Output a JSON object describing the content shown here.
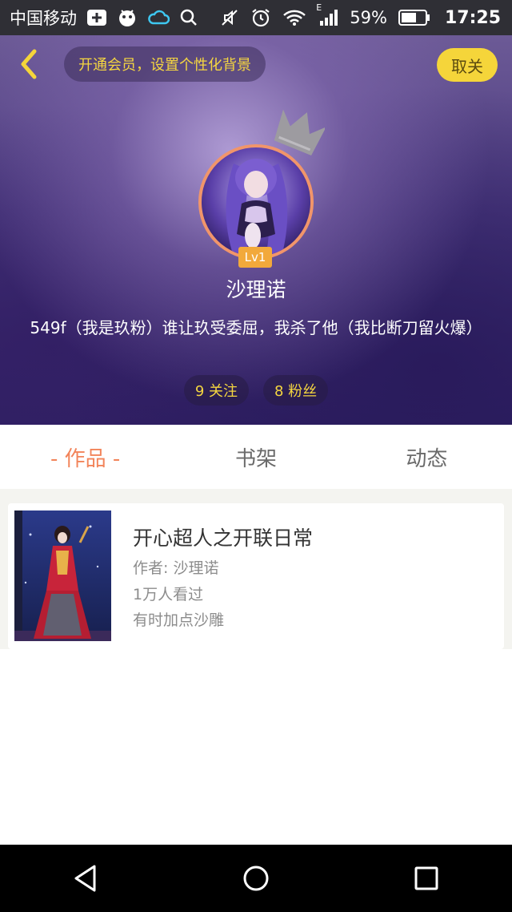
{
  "status_bar": {
    "carrier": "中国移动",
    "network": "E",
    "battery": "59%",
    "time": "17:25"
  },
  "header": {
    "vip_banner": "开通会员，设置个性化背景",
    "unfollow_label": "取关"
  },
  "profile": {
    "level": "Lv1",
    "name": "沙理诺",
    "bio": "549f（我是玖粉）谁让玖受委屈，我杀了他（我比断刀留火爆）",
    "following": "9 关注",
    "followers": "8 粉丝"
  },
  "tabs": [
    {
      "label": "- 作品 -",
      "active": true
    },
    {
      "label": "书架",
      "active": false
    },
    {
      "label": "动态",
      "active": false
    }
  ],
  "works": [
    {
      "title": "开心超人之开联日常",
      "author": "作者: 沙理诺",
      "views": "1万人看过",
      "description": "有时加点沙雕"
    }
  ],
  "colors": {
    "accent_yellow": "#f5d53a",
    "active_tab": "#f2845a",
    "avatar_ring": "#f1956a",
    "level_badge": "#f2a93b"
  },
  "icons": {
    "back": "chevron-left-icon",
    "crown": "crown-icon",
    "nav_back": "triangle-back-icon",
    "nav_home": "circle-home-icon",
    "nav_recents": "square-recents-icon"
  }
}
